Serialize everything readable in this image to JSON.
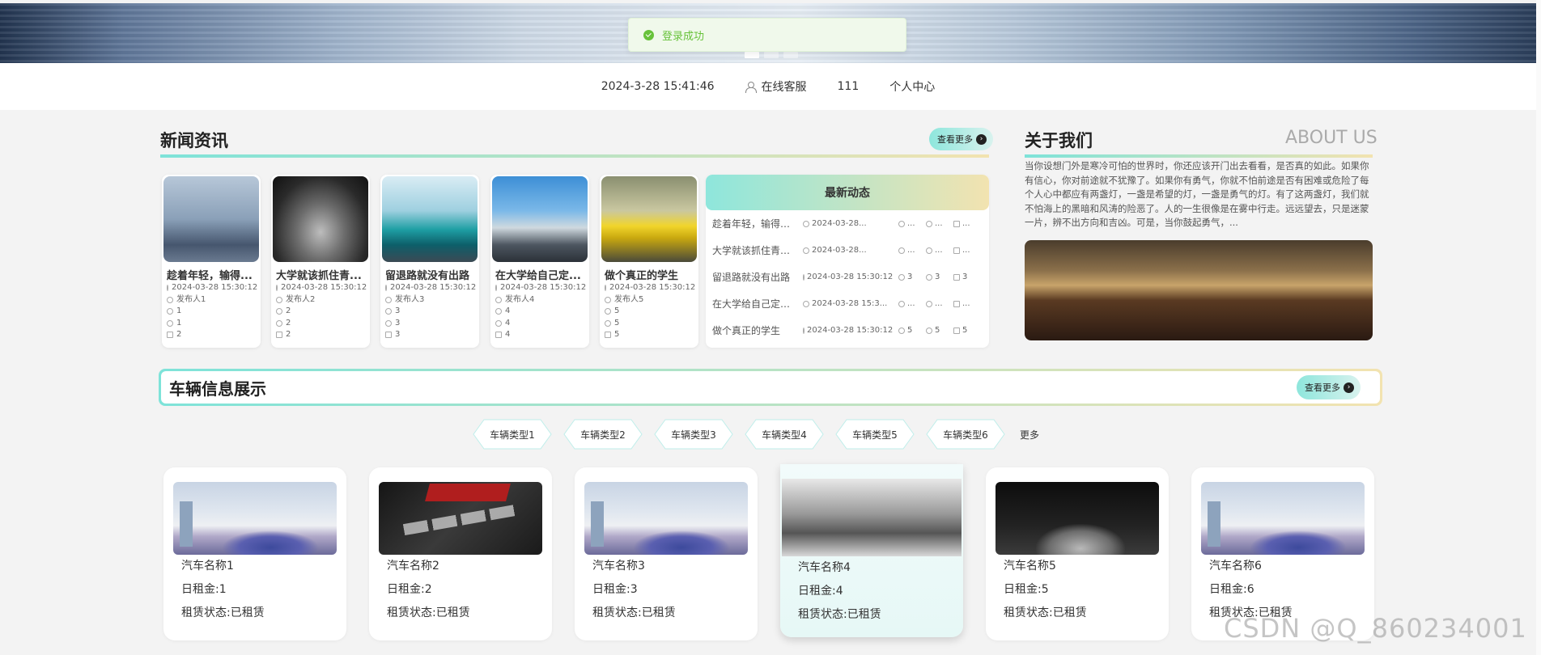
{
  "toast": {
    "message": "登录成功"
  },
  "topbar": {
    "datetime": "2024-3-28 15:41:46",
    "service": "在线客服",
    "username": "111",
    "profile": "个人中心"
  },
  "news": {
    "title": "新闻资讯",
    "more_label": "查看更多",
    "cards": [
      {
        "title": "趁着年轻，输得...",
        "time": "2024-03-28 15:30:12",
        "publisher": "发布人1",
        "likes": "1",
        "favorites": "1",
        "views": "2"
      },
      {
        "title": "大学就该抓住青...",
        "time": "2024-03-28 15:30:12",
        "publisher": "发布人2",
        "likes": "2",
        "favorites": "2",
        "views": "2"
      },
      {
        "title": "留退路就没有出路",
        "time": "2024-03-28 15:30:12",
        "publisher": "发布人3",
        "likes": "3",
        "favorites": "3",
        "views": "3"
      },
      {
        "title": "在大学给自己定...",
        "time": "2024-03-28 15:30:12",
        "publisher": "发布人4",
        "likes": "4",
        "favorites": "4",
        "views": "4"
      },
      {
        "title": "做个真正的学生",
        "time": "2024-03-28 15:30:12",
        "publisher": "发布人5",
        "likes": "5",
        "favorites": "5",
        "views": "5"
      }
    ],
    "latest": {
      "title": "最新动态",
      "rows": [
        {
          "title": "趁着年轻，输得起，看...",
          "time": "2024-03-28...",
          "likes": "...",
          "favorites": "...",
          "views": "..."
        },
        {
          "title": "大学就该抓住青春，用...",
          "time": "2024-03-28...",
          "likes": "...",
          "favorites": "...",
          "views": "..."
        },
        {
          "title": "留退路就没有出路",
          "time": "2024-03-28 15:30:12",
          "likes": "3",
          "favorites": "3",
          "views": "3"
        },
        {
          "title": "在大学给自己定个...",
          "time": "2024-03-28 15:3...",
          "likes": "...",
          "favorites": "...",
          "views": "..."
        },
        {
          "title": "做个真正的学生",
          "time": "2024-03-28 15:30:12",
          "likes": "5",
          "favorites": "5",
          "views": "5"
        }
      ]
    }
  },
  "about": {
    "title": "关于我们",
    "title_en": "ABOUT US",
    "text": "当你设想门外是寒冷可怕的世界时，你还应该开门出去看看，是否真的如此。如果你有信心，你对前途就不犹豫了。如果你有勇气，你就不怕前途是否有困难或危险了每个人心中都应有两盏灯，一盏是希望的灯，一盏是勇气的灯。有了这两盏灯，我们就不怕海上的黑暗和风涛的险恶了。人的一生很像是在雾中行走。远远望去，只是迷蒙一片，辨不出方向和吉凶。可是，当你鼓起勇气，..."
  },
  "vehicles": {
    "title": "车辆信息展示",
    "more_label": "查看更多",
    "tabs": [
      "车辆类型1",
      "车辆类型2",
      "车辆类型3",
      "车辆类型4",
      "车辆类型5",
      "车辆类型6"
    ],
    "tabs_more": "更多",
    "cars": [
      {
        "name": "汽车名称1",
        "rent": "日租金:1",
        "status": "租赁状态:已租赁"
      },
      {
        "name": "汽车名称2",
        "rent": "日租金:2",
        "status": "租赁状态:已租赁"
      },
      {
        "name": "汽车名称3",
        "rent": "日租金:3",
        "status": "租赁状态:已租赁"
      },
      {
        "name": "汽车名称4",
        "rent": "日租金:4",
        "status": "租赁状态:已租赁"
      },
      {
        "name": "汽车名称5",
        "rent": "日租金:5",
        "status": "租赁状态:已租赁"
      },
      {
        "name": "汽车名称6",
        "rent": "日租金:6",
        "status": "租赁状态:已租赁"
      }
    ]
  },
  "watermark": "CSDN @Q_860234001"
}
